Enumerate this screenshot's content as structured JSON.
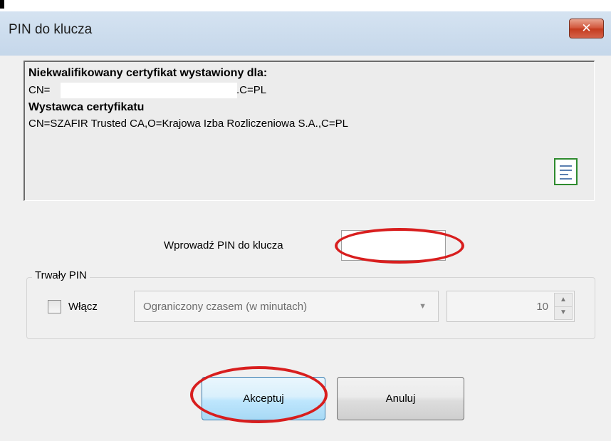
{
  "window": {
    "title": "PIN do klucza",
    "close_symbol": "✕"
  },
  "certificate": {
    "subject_heading": "Niekwalifikowany certyfikat wystawiony dla:",
    "subject_prefix": "CN=",
    "subject_suffix": ".C=PL",
    "issuer_heading": "Wystawca certyfikatu",
    "issuer_value": "CN=SZAFIR Trusted CA,O=Krajowa Izba Rozliczeniowa S.A.,C=PL",
    "icon": "certificate-icon"
  },
  "pin": {
    "label": "Wprowadź PIN do klucza",
    "value": ""
  },
  "persistent_pin": {
    "legend": "Trwały PIN",
    "checkbox_label": "Włącz",
    "checked": false,
    "mode_selected": "Ograniczony czasem (w minutach)",
    "minutes": "10"
  },
  "buttons": {
    "accept": "Akceptuj",
    "cancel": "Anuluj"
  },
  "colors": {
    "annotation": "#d81e1e",
    "close_button": "#c43b1e",
    "accept_border": "#3c7fb1"
  }
}
